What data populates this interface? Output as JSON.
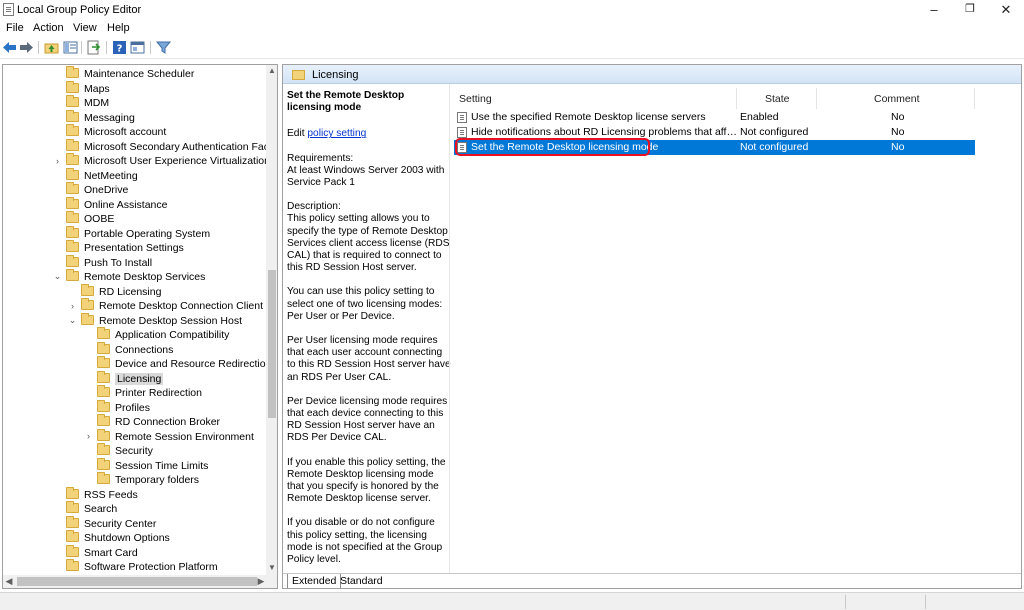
{
  "window": {
    "title": "Local Group Policy Editor",
    "controls": [
      "–",
      "❐",
      "✕"
    ]
  },
  "menu": [
    "File",
    "Action",
    "View",
    "Help"
  ],
  "tree": {
    "items": [
      {
        "label": "Maintenance Scheduler"
      },
      {
        "label": "Maps"
      },
      {
        "label": "MDM"
      },
      {
        "label": "Messaging"
      },
      {
        "label": "Microsoft account"
      },
      {
        "label": "Microsoft Secondary Authentication Factor"
      },
      {
        "label": "Microsoft User Experience Virtualization"
      },
      {
        "label": "NetMeeting"
      },
      {
        "label": "OneDrive"
      },
      {
        "label": "Online Assistance"
      },
      {
        "label": "OOBE"
      },
      {
        "label": "Portable Operating System"
      },
      {
        "label": "Presentation Settings"
      },
      {
        "label": "Push To Install"
      },
      {
        "label": "Remote Desktop Services"
      },
      {
        "label": "RD Licensing"
      },
      {
        "label": "Remote Desktop Connection Client"
      },
      {
        "label": "Remote Desktop Session Host"
      },
      {
        "label": "Application Compatibility"
      },
      {
        "label": "Connections"
      },
      {
        "label": "Device and Resource Redirection"
      },
      {
        "label": "Licensing"
      },
      {
        "label": "Printer Redirection"
      },
      {
        "label": "Profiles"
      },
      {
        "label": "RD Connection Broker"
      },
      {
        "label": "Remote Session Environment"
      },
      {
        "label": "Security"
      },
      {
        "label": "Session Time Limits"
      },
      {
        "label": "Temporary folders"
      },
      {
        "label": "RSS Feeds"
      },
      {
        "label": "Search"
      },
      {
        "label": "Security Center"
      },
      {
        "label": "Shutdown Options"
      },
      {
        "label": "Smart Card"
      },
      {
        "label": "Software Protection Platform"
      }
    ]
  },
  "right": {
    "folder_title": "Licensing",
    "description": {
      "heading": "Set the Remote Desktop licensing mode",
      "edit_prefix": "Edit ",
      "edit_link": "policy setting",
      "requirements": "Requirements:\nAt least Windows Server 2003 with Service Pack 1",
      "paragraphs": [
        "Description:\nThis policy setting allows you to specify the type of Remote Desktop Services client access license (RDS CAL) that is required to connect to this RD Session Host server.",
        "You can use this policy setting to select one of two licensing modes: Per User or Per Device.",
        "Per User licensing mode requires that each user account connecting to this RD Session Host server have an RDS Per User CAL.",
        "Per Device licensing mode requires that each device connecting to this RD Session Host server have an RDS Per Device CAL.",
        "If you enable this policy setting, the Remote Desktop licensing mode that you specify is honored by the Remote Desktop license server.",
        "If you disable or do not configure this policy setting, the licensing mode is not specified at the Group Policy level."
      ]
    },
    "columns": {
      "setting": "Setting",
      "state": "State",
      "comment": "Comment"
    },
    "rows": [
      {
        "setting": "Use the specified Remote Desktop license servers",
        "state": "Enabled",
        "comment": "No"
      },
      {
        "setting": "Hide notifications about RD Licensing problems that affect t...",
        "state": "Not configured",
        "comment": "No"
      },
      {
        "setting": "Set the Remote Desktop licensing mode",
        "state": "Not configured",
        "comment": "No"
      }
    ],
    "tabs": [
      "Extended",
      "Standard"
    ]
  }
}
